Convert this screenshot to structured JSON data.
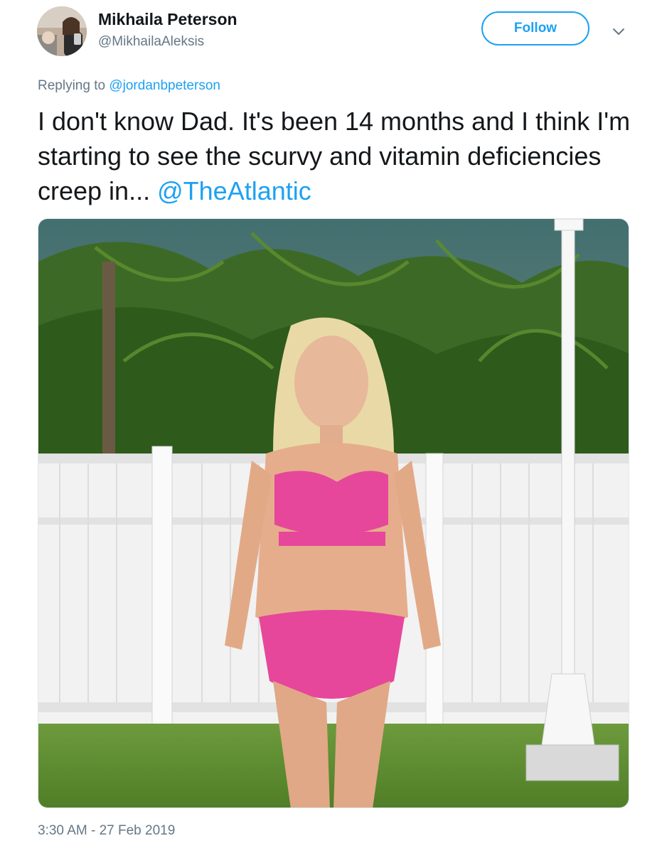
{
  "tweet": {
    "author": {
      "display_name": "Mikhaila Peterson",
      "handle": "@MikhailaAleksis",
      "avatar_icon": "profile-photo"
    },
    "follow_label": "Follow",
    "menu_icon": "chevron-down-icon",
    "reply_context": {
      "prefix": "Replying to",
      "mention": "@jordanbpeterson"
    },
    "text": {
      "body": "I don't know Dad. It's been 14 months and I think I'm starting to see the scurvy and vitamin deficiencies creep in...",
      "mention": "@TheAtlantic"
    },
    "media": {
      "description_icon": "photo"
    },
    "timestamp": "3:30 AM - 27 Feb 2019"
  },
  "colors": {
    "link_blue": "#1da1f2",
    "secondary_text": "#657786",
    "primary_text": "#14171a"
  }
}
